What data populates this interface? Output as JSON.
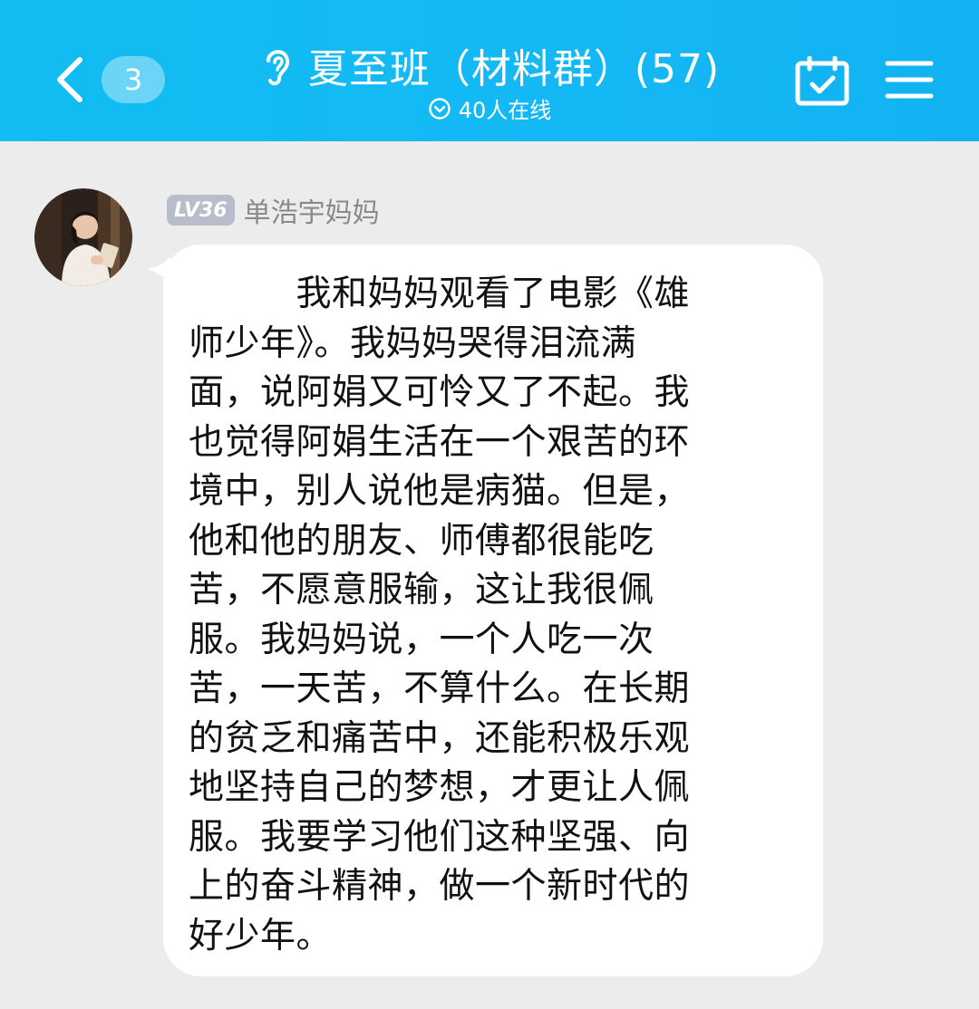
{
  "header": {
    "back_label": "<",
    "unread_count": "3",
    "group_title": "夏至班（材料群）(57)",
    "online_status": "40人在线",
    "icons": {
      "back": "chevron-left-icon",
      "ear": "ear-icon",
      "online": "chevron-down-circle-icon",
      "calendar": "calendar-check-icon",
      "menu": "hamburger-menu-icon"
    },
    "colors": {
      "background": "#14b8f4",
      "text": "#ffffff"
    }
  },
  "message": {
    "sender_level": "LV36",
    "sender_name": "单浩宇妈妈",
    "lines": [
      "　　　我和妈妈观看了电影《雄",
      "师少年》。我妈妈哭得泪流满",
      "面，说阿娟又可怜又了不起。我",
      "也觉得阿娟生活在一个艰苦的环",
      "境中，别人说他是病猫。但是，",
      "他和他的朋友、师傅都很能吃",
      "苦，不愿意服输，这让我很佩",
      "服。我妈妈说，一个人吃一次",
      "苦，一天苦，不算什么。在长期",
      "的贫乏和痛苦中，还能积极乐观",
      "地坚持自己的梦想，才更让人佩",
      "服。我要学习他们这种坚强、向",
      "上的奋斗精神，做一个新时代的",
      "好少年。"
    ],
    "colors": {
      "bubble": "#ffffff",
      "text": "#111111",
      "level_badge": "#b9bccb"
    }
  },
  "chat": {
    "background": "#ececec"
  }
}
